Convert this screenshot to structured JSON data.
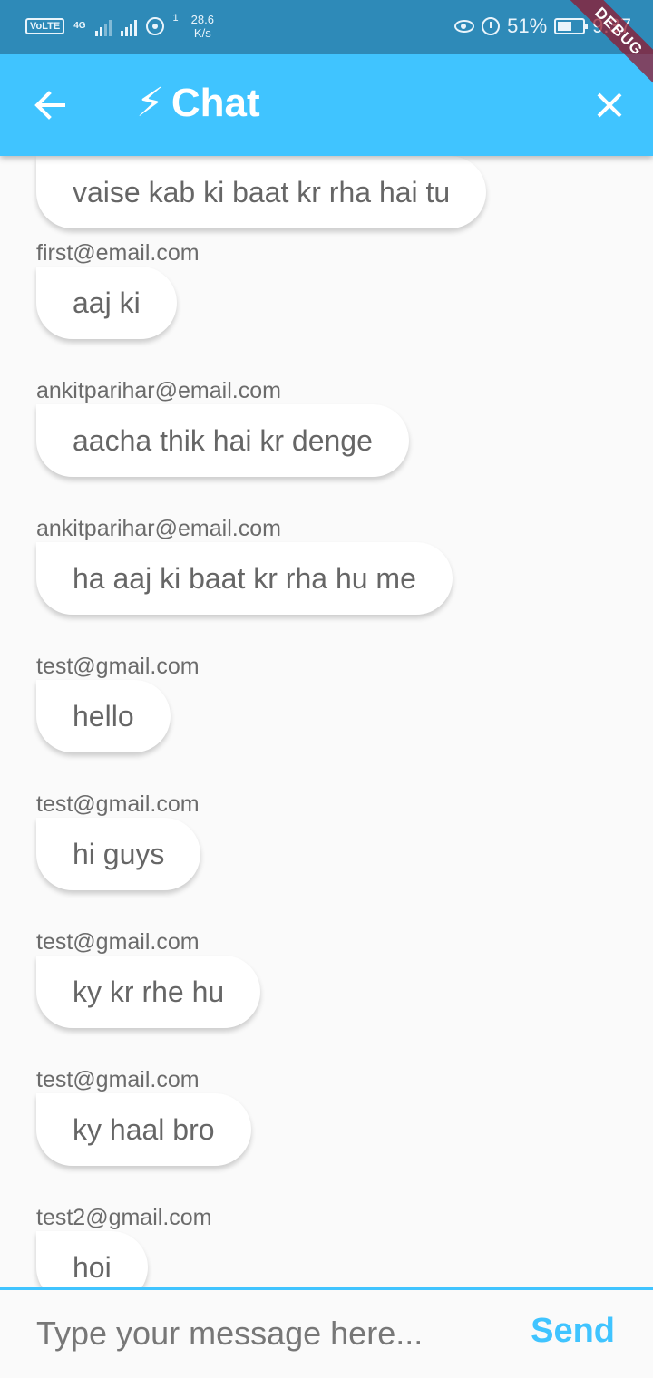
{
  "status_bar": {
    "volte": "VoLTE",
    "network": "4G",
    "net_speed_value": "28.6",
    "net_speed_unit": "K/s",
    "hotspot_count": "1",
    "battery": "51%",
    "time": "9:37"
  },
  "debug_banner": "DEBUG",
  "app_bar": {
    "title": "Chat",
    "title_icon": "⚡"
  },
  "messages": [
    {
      "sender": "",
      "text": "vaise kab ki baat kr rha hai tu"
    },
    {
      "sender": "first@email.com",
      "text": "aaj ki"
    },
    {
      "sender": "ankitparihar@email.com",
      "text": "aacha thik hai kr denge"
    },
    {
      "sender": "ankitparihar@email.com",
      "text": "ha aaj ki baat kr rha hu me"
    },
    {
      "sender": "test@gmail.com",
      "text": "hello"
    },
    {
      "sender": "test@gmail.com",
      "text": "hi guys"
    },
    {
      "sender": "test@gmail.com",
      "text": "ky kr rhe hu"
    },
    {
      "sender": "test@gmail.com",
      "text": "ky haal bro"
    },
    {
      "sender": "test2@gmail.com",
      "text": "hoi"
    }
  ],
  "composer": {
    "placeholder": "Type your message here...",
    "value": "",
    "send_label": "Send"
  },
  "colors": {
    "status_bar": "#2e8ab8",
    "accent": "#40c4ff",
    "background": "#fafafa"
  }
}
